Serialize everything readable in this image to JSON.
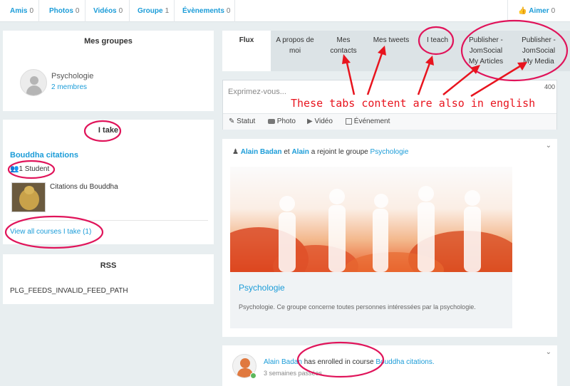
{
  "topnav": {
    "items": [
      {
        "label": "Amis",
        "count": "0"
      },
      {
        "label": "Photos",
        "count": "0"
      },
      {
        "label": "Vidéos",
        "count": "0"
      },
      {
        "label": "Groupe",
        "count": "1"
      },
      {
        "label": "Évènements",
        "count": "0"
      }
    ],
    "like_label": "Aimer",
    "like_count": "0"
  },
  "groups_panel": {
    "title": "Mes groupes",
    "group_name": "Psychologie",
    "group_members": "2 membres"
  },
  "take_panel": {
    "title": "I take",
    "course_title": "Bouddha citations",
    "students": "1 Student",
    "course_desc": "Citations du Bouddha",
    "view_all": "View all courses I take (1)"
  },
  "rss_panel": {
    "title": "RSS",
    "error": "PLG_FEEDS_INVALID_FEED_PATH"
  },
  "tabs": [
    {
      "line1": "Flux",
      "line2": ""
    },
    {
      "line1": "A propos de",
      "line2": "moi"
    },
    {
      "line1": "Mes",
      "line2": "contacts"
    },
    {
      "line1": "Mes tweets",
      "line2": ""
    },
    {
      "line1": "I teach",
      "line2": ""
    },
    {
      "line1": "Publisher -",
      "line2": "JomSocial",
      "line3": "My Articles"
    },
    {
      "line1": "Publisher -",
      "line2": "JomSocial",
      "line3": "My Media"
    }
  ],
  "composer": {
    "placeholder": "Exprimez-vous...",
    "char_count": "400",
    "actions": [
      "Statut",
      "Photo",
      "Vidéo",
      "Événement"
    ]
  },
  "annotation_text": "These tabs content are also in english",
  "activity1": {
    "user1": "Alain Badan",
    "conj": "et",
    "user2": "Alain",
    "action": "a rejoint le groupe",
    "group": "Psychologie",
    "card_title": "Psychologie",
    "card_desc": "Psychologie. Ce groupe concerne toutes personnes intéressées par la psychologie."
  },
  "activity2": {
    "user": "Alain Badan",
    "action": "has enrolled in course",
    "course": "Bouddha citations.",
    "time": "3 semaines passées"
  },
  "colors": {
    "accent": "#1b9cd8",
    "annotation": "#e0145a",
    "arrow": "#e8141e"
  }
}
